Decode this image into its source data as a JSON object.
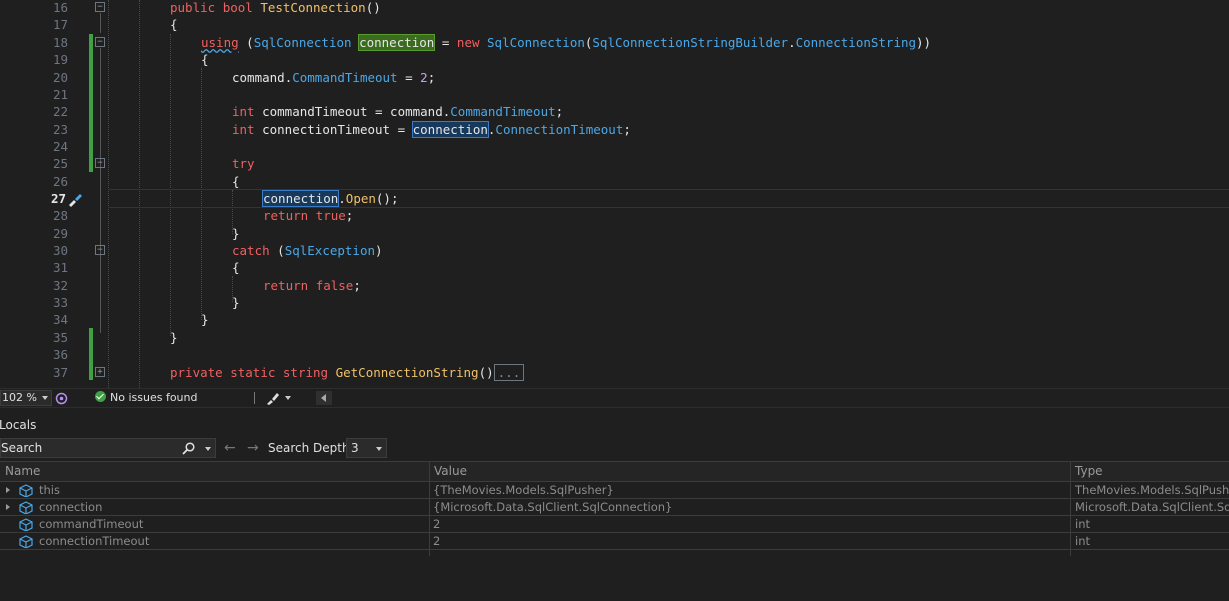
{
  "editor": {
    "lines": [
      {
        "n": "16"
      },
      {
        "n": "17"
      },
      {
        "n": "18"
      },
      {
        "n": "19"
      },
      {
        "n": "20"
      },
      {
        "n": "21"
      },
      {
        "n": "22"
      },
      {
        "n": "23"
      },
      {
        "n": "24"
      },
      {
        "n": "25"
      },
      {
        "n": "26"
      },
      {
        "n": "27"
      },
      {
        "n": "28"
      },
      {
        "n": "29"
      },
      {
        "n": "30"
      },
      {
        "n": "31"
      },
      {
        "n": "32"
      },
      {
        "n": "33"
      },
      {
        "n": "34"
      },
      {
        "n": "35"
      },
      {
        "n": "36"
      },
      {
        "n": "37"
      }
    ],
    "tokens": {
      "public": "public",
      "bool": "bool",
      "test_connection": "TestConnection",
      "parens": "()",
      "open_brace": "{",
      "close_brace": "}",
      "using": "using",
      "open_paren": " (",
      "sql_connection": "SqlConnection",
      "connection": "connection",
      "eq": " = ",
      "new": "new",
      "sql_conn_ctor": "SqlConnection",
      "builder": "SqlConnectionStringBuilder",
      "dot": ".",
      "connection_string": "ConnectionString",
      "close2": "))",
      "command": "command",
      "command_timeout": "CommandTimeout",
      "two": "2",
      "semi": ";",
      "int": "int",
      "command_timeout_var": "commandTimeout",
      "connection_timeout_var": "connectionTimeout",
      "connection_timeout_prop": "ConnectionTimeout",
      "try": "try",
      "open": "Open",
      "open_call": "();",
      "return": "return",
      "true": "true",
      "false": "false",
      "catch": "catch",
      "sql_exception": "SqlException",
      "close_paren": ")",
      "private": "private",
      "static": "static",
      "string": "string",
      "get_conn_string": "GetConnectionString",
      "ellipsis": "..."
    }
  },
  "status": {
    "zoom": "102 %",
    "issues": "No issues found"
  },
  "locals": {
    "title": "Locals",
    "search_placeholder": "Search",
    "back_arrow": "←",
    "forward_arrow": "→",
    "depth_label": "Search Depth:",
    "depth_value": "3",
    "columns": {
      "name": "Name",
      "value": "Value",
      "type": "Type"
    },
    "rows": [
      {
        "name": "this",
        "value": "{TheMovies.Models.SqlPusher}",
        "type": "TheMovies.Models.SqlPusher",
        "expandable": true
      },
      {
        "name": "connection",
        "value": "{Microsoft.Data.SqlClient.SqlConnection}",
        "type": "Microsoft.Data.SqlClient.SqlConnection",
        "expandable": true
      },
      {
        "name": "commandTimeout",
        "value": "2",
        "type": "int",
        "expandable": false
      },
      {
        "name": "connectionTimeout",
        "value": "2",
        "type": "int",
        "expandable": false
      }
    ]
  },
  "colors": {
    "background": "#1f1f1f",
    "keyword": "#f06060",
    "type": "#4aa8e8",
    "method": "#f0c06a",
    "number": "#c8a0f0",
    "change_bar": "#3ea142"
  }
}
